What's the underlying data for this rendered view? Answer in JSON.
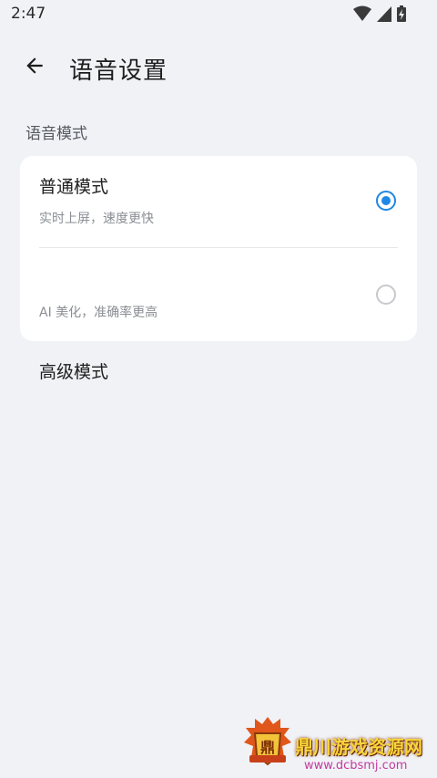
{
  "status_bar": {
    "time": "2:47",
    "icons": [
      "wifi-icon",
      "cellular-signal-icon",
      "battery-charging-icon"
    ]
  },
  "header": {
    "back_icon": "arrow-left-icon",
    "title": "语音设置"
  },
  "section": {
    "label": "语音模式"
  },
  "options": [
    {
      "title": "普通模式",
      "description": "实时上屏，速度更快",
      "selected": true
    },
    {
      "title": "高级模式",
      "description": "AI 美化，准确率更高",
      "selected": false
    }
  ],
  "watermark": {
    "name": "鼎川游戏资源网",
    "url": "www.dcbsmj.com",
    "emblem_text": "鼎"
  },
  "colors": {
    "background": "#f1f2f6",
    "card": "#ffffff",
    "accent": "#1e88e5",
    "radio_off": "#c7c9cd"
  }
}
